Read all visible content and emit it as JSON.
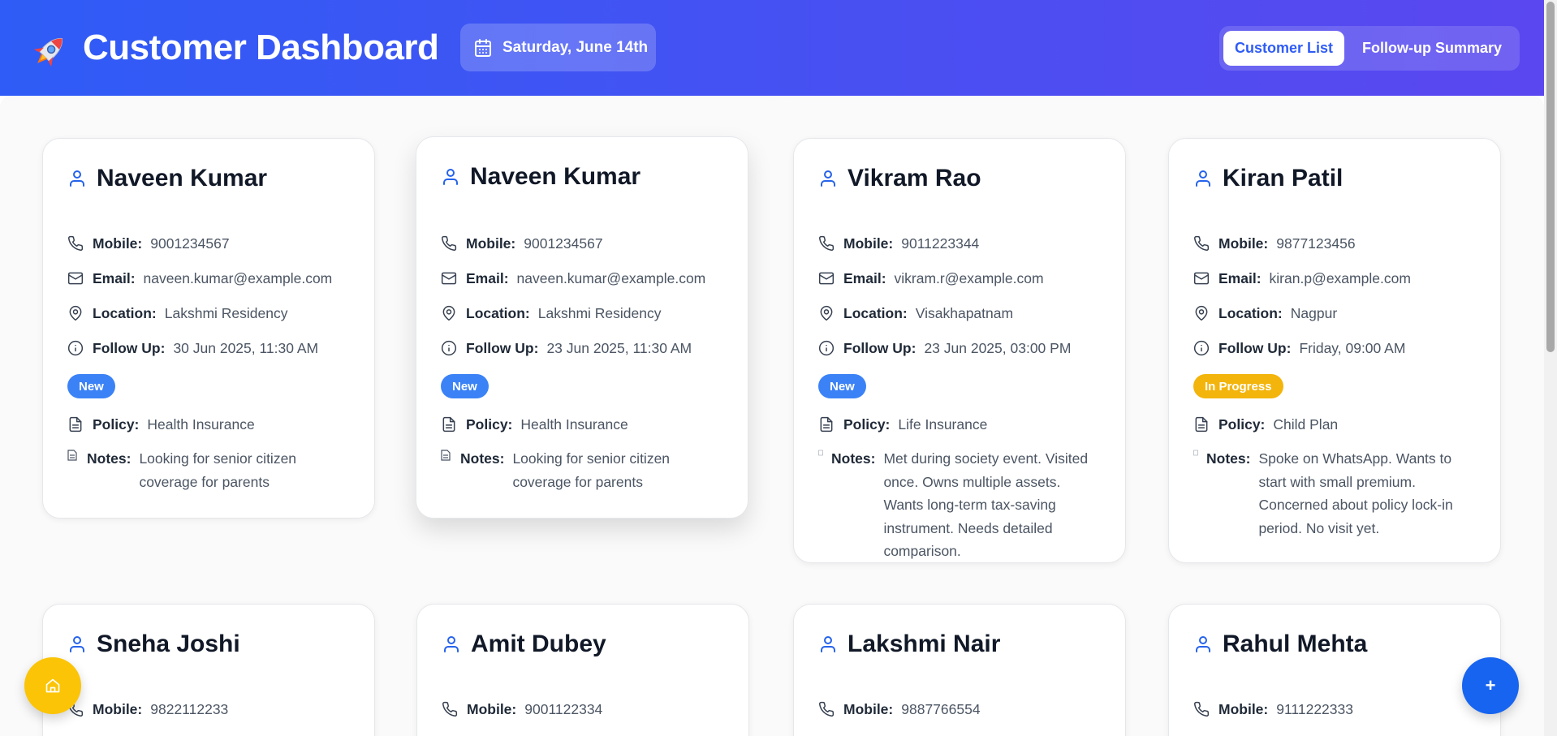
{
  "header": {
    "title": "Customer Dashboard",
    "date": "Saturday, June 14th",
    "tabs": [
      {
        "label": "Customer List",
        "active": true
      },
      {
        "label": "Follow-up Summary",
        "active": false
      }
    ]
  },
  "labels": {
    "mobile": "Mobile:",
    "email": "Email:",
    "location": "Location:",
    "follow_up": "Follow Up:",
    "policy": "Policy:",
    "notes": "Notes:"
  },
  "customers": [
    {
      "name": "Naveen Kumar",
      "mobile": "9001234567",
      "email": "naveen.kumar@example.com",
      "location": "Lakshmi Residency",
      "follow_up": "30 Jun 2025, 11:30 AM",
      "status": "New",
      "policy": "Health Insurance",
      "notes": "Looking for senior citizen coverage for parents"
    },
    {
      "name": "Naveen Kumar",
      "mobile": "9001234567",
      "email": "naveen.kumar@example.com",
      "location": "Lakshmi Residency",
      "follow_up": "23 Jun 2025, 11:30 AM",
      "status": "New",
      "policy": "Health Insurance",
      "notes": "Looking for senior citizen coverage for parents"
    },
    {
      "name": "Vikram Rao",
      "mobile": "9011223344",
      "email": "vikram.r@example.com",
      "location": "Visakhapatnam",
      "follow_up": "23 Jun 2025, 03:00 PM",
      "status": "New",
      "policy": "Life Insurance",
      "notes": "Met during society event. Visited once. Owns multiple assets. Wants long-term tax-saving instrument. Needs detailed comparison."
    },
    {
      "name": "Kiran Patil",
      "mobile": "9877123456",
      "email": "kiran.p@example.com",
      "location": "Nagpur",
      "follow_up": "Friday, 09:00 AM",
      "status": "In Progress",
      "policy": "Child Plan",
      "notes": "Spoke on WhatsApp. Wants to start with small premium. Concerned about policy lock-in period. No visit yet."
    },
    {
      "name": "Sneha Joshi",
      "mobile": "9822112233"
    },
    {
      "name": "Amit Dubey",
      "mobile": "9001122334"
    },
    {
      "name": "Lakshmi Nair",
      "mobile": "9887766554"
    },
    {
      "name": "Rahul Mehta",
      "mobile": "9111222333"
    }
  ],
  "fab": {
    "home_icon": "home-icon",
    "add_symbol": "+"
  },
  "colors": {
    "header_gradient_start": "#2f5cf6",
    "header_gradient_end": "#5a47ef",
    "badge_new": "#3b82f6",
    "badge_in_progress": "#f3b40b",
    "fab_home": "#fbc406",
    "fab_add": "#1764f0"
  }
}
